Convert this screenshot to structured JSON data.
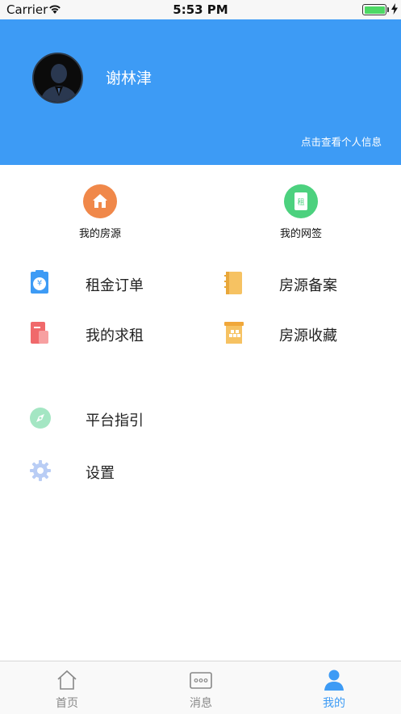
{
  "status_bar": {
    "carrier": "Carrier",
    "time": "5:53 PM"
  },
  "header": {
    "user_name": "谢林津",
    "profile_link": "点击查看个人信息"
  },
  "quick_actions": [
    {
      "label": "我的房源",
      "icon": "house-icon",
      "color": "#f0884a"
    },
    {
      "label": "我的网签",
      "icon": "contract-icon",
      "color": "#4cd17e",
      "glyph": "租"
    }
  ],
  "menu": {
    "rent_orders": "租金订单",
    "house_filing": "房源备案",
    "my_requests": "我的求租",
    "house_favorites": "房源收藏",
    "platform_guide": "平台指引",
    "settings": "设置"
  },
  "rent_order_glyph": "¥",
  "tabs": [
    {
      "label": "首页",
      "icon": "home-icon",
      "active": false
    },
    {
      "label": "消息",
      "icon": "message-icon",
      "active": false
    },
    {
      "label": "我的",
      "icon": "profile-icon",
      "active": true
    }
  ],
  "colors": {
    "header": "#3d9bf5",
    "active_tab": "#3d9bf5"
  }
}
